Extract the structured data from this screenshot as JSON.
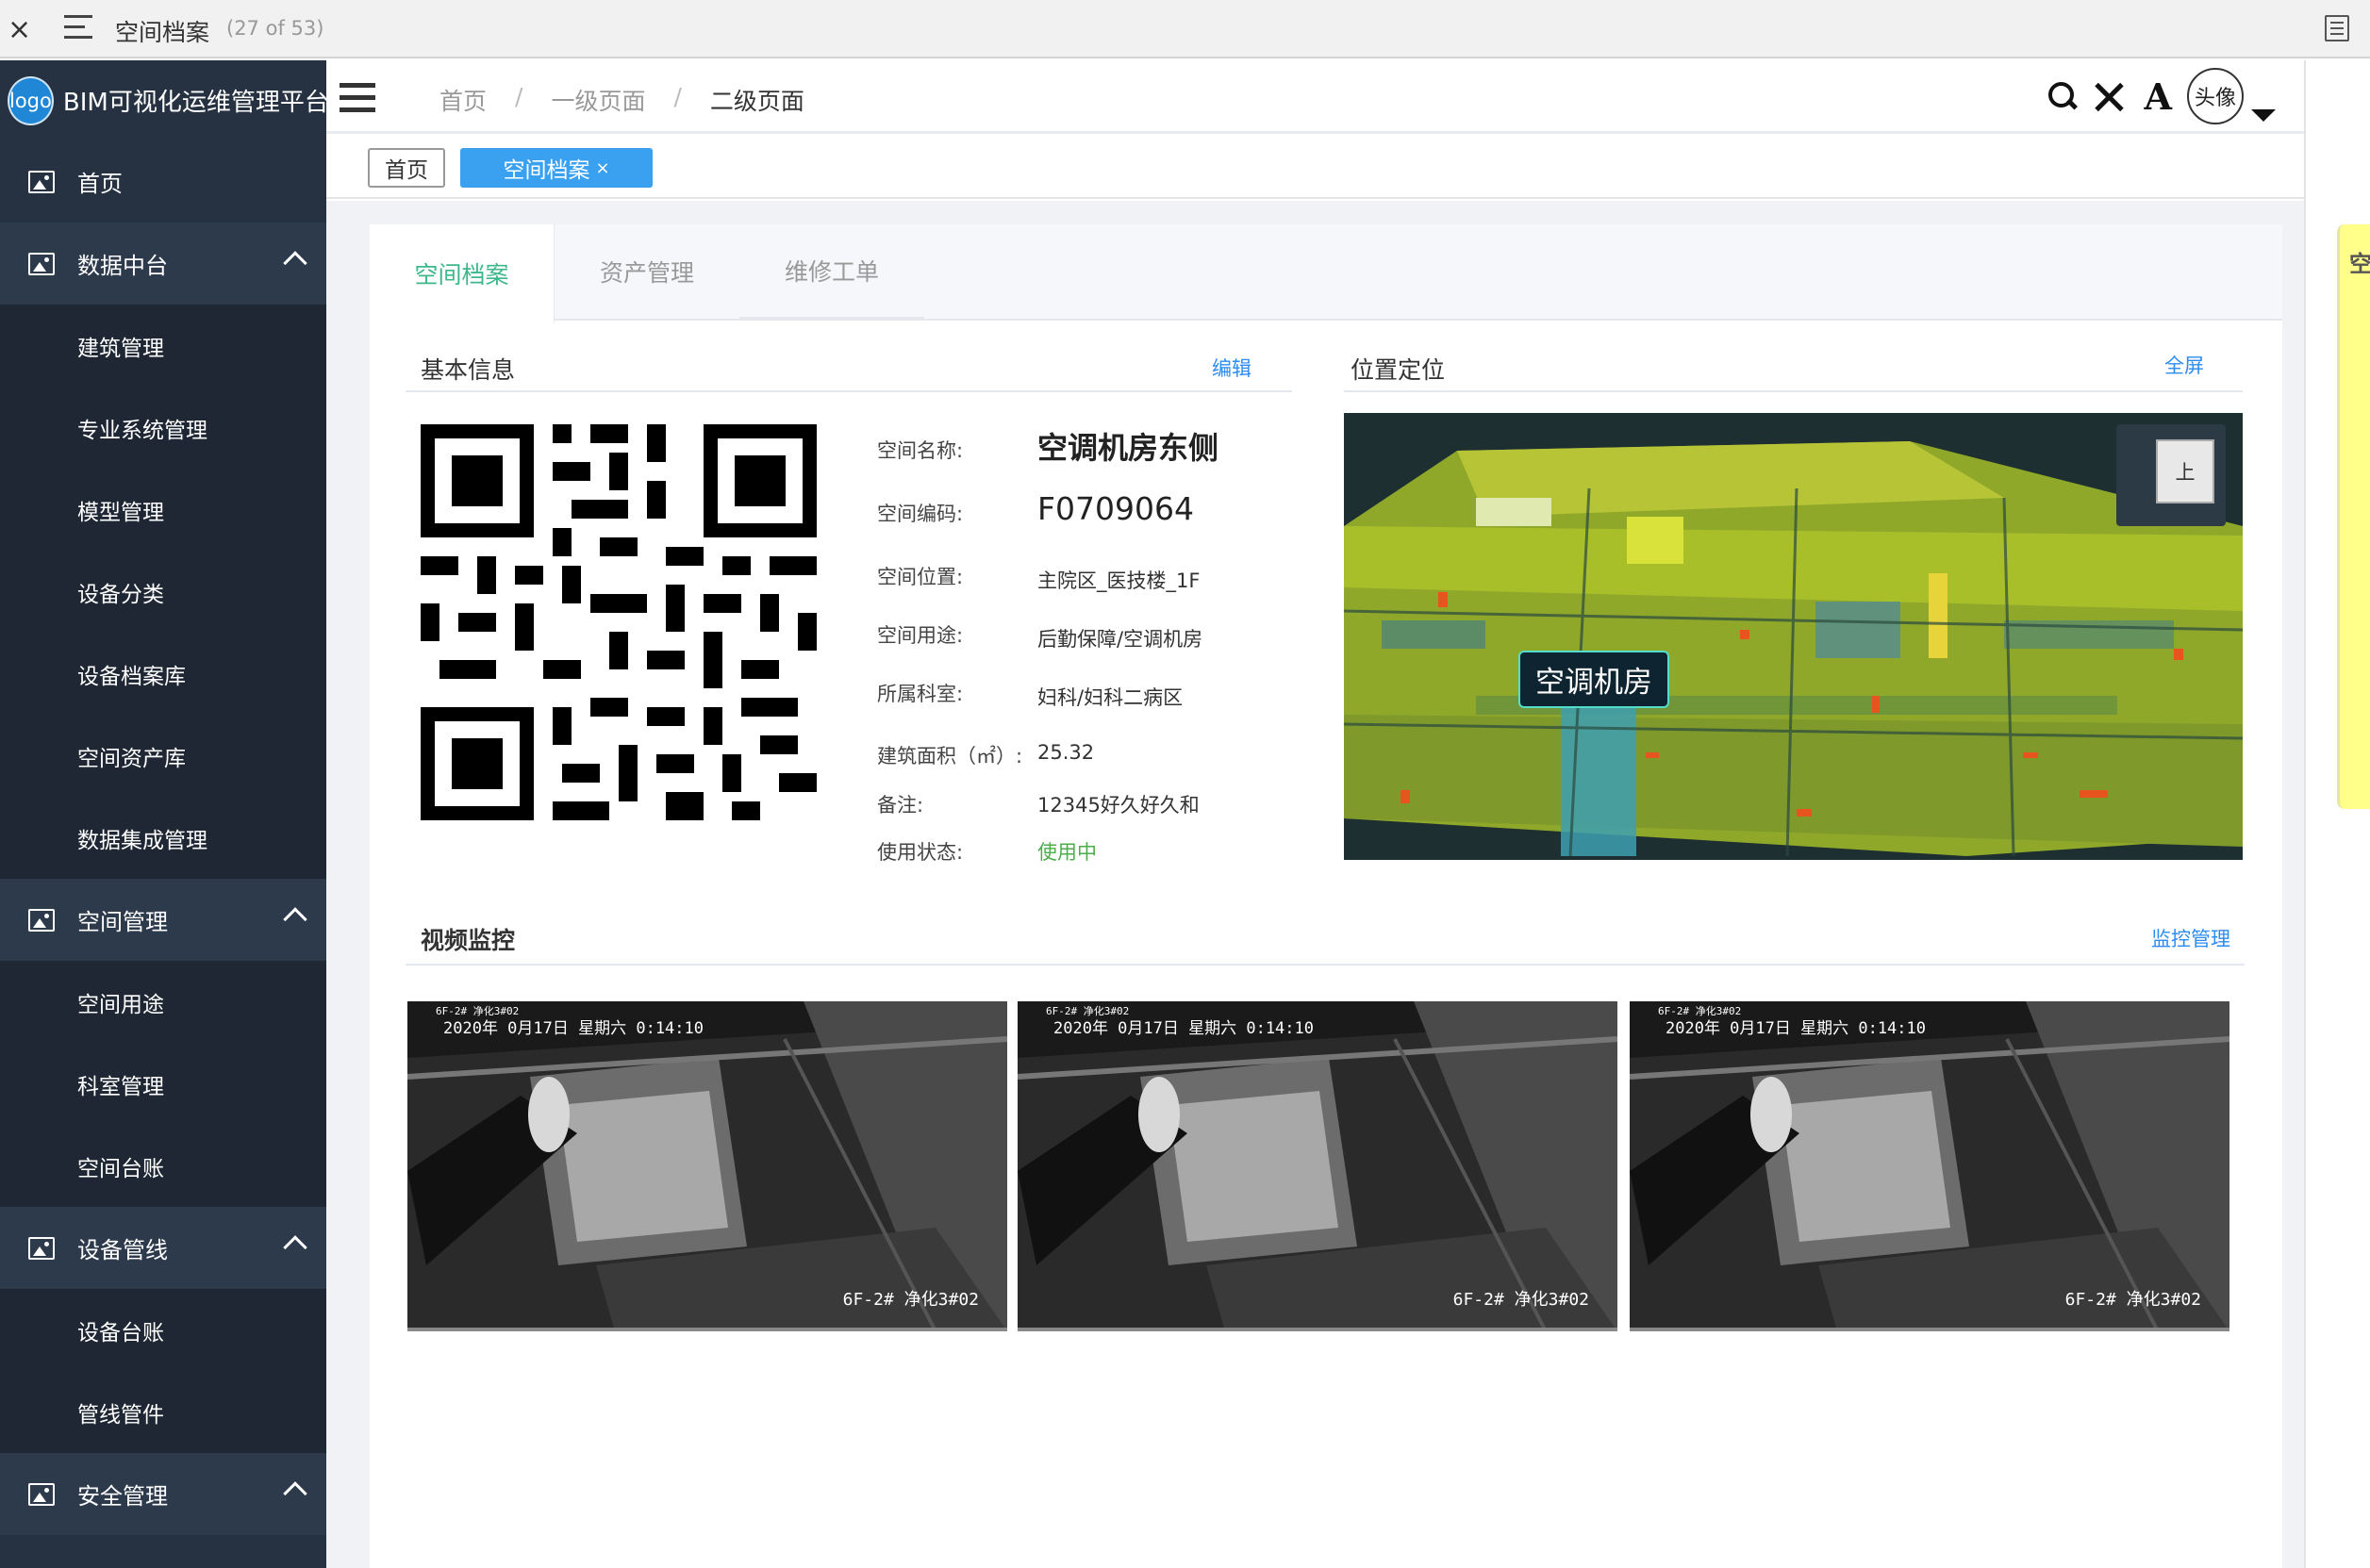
{
  "viewer": {
    "close": "×",
    "title": "空间档案",
    "count": "(27 of 53)"
  },
  "brand": {
    "logo": "logo",
    "name": "BIM可视化运维管理平台"
  },
  "sidebar": {
    "items": [
      {
        "label": "首页"
      },
      {
        "label": "数据中台"
      },
      {
        "label": "建筑管理"
      },
      {
        "label": "专业系统管理"
      },
      {
        "label": "模型管理"
      },
      {
        "label": "设备分类"
      },
      {
        "label": "设备档案库"
      },
      {
        "label": "空间资产库"
      },
      {
        "label": "数据集成管理"
      },
      {
        "label": "空间管理"
      },
      {
        "label": "空间用途"
      },
      {
        "label": "科室管理"
      },
      {
        "label": "空间台账"
      },
      {
        "label": "设备管线"
      },
      {
        "label": "设备台账"
      },
      {
        "label": "管线管件"
      },
      {
        "label": "安全管理"
      }
    ]
  },
  "breadcrumb": {
    "home": "首页",
    "sep1": "/",
    "level1": "一级页面",
    "sep2": "/",
    "level2": "二级页面"
  },
  "header": {
    "font_icon": "A",
    "avatar": "头像"
  },
  "tags": {
    "home": "首页",
    "active": "空间档案",
    "close": "×"
  },
  "tabs": [
    {
      "label": "空间档案"
    },
    {
      "label": "资产管理"
    },
    {
      "label": "维修工单"
    }
  ],
  "basic": {
    "title": "基本信息",
    "edit": "编辑",
    "fields": [
      {
        "label": "空间名称:",
        "value": "空调机房东侧"
      },
      {
        "label": "空间编码:",
        "value": "F0709064"
      },
      {
        "label": "空间位置:",
        "value": "主院区_医技楼_1F"
      },
      {
        "label": "空间用途:",
        "value": "后勤保障/空调机房"
      },
      {
        "label": "所属科室:",
        "value": "妇科/妇科二病区"
      },
      {
        "label": "建筑面积（㎡）:",
        "value": "25.32"
      },
      {
        "label": "备注:",
        "value": "12345好久好久和"
      },
      {
        "label": "使用状态:",
        "value": "使用中"
      }
    ]
  },
  "location": {
    "title": "位置定位",
    "fullscreen": "全屏",
    "label": "空调机房",
    "cube_face": "上"
  },
  "video": {
    "title": "视频监控",
    "manage": "监控管理",
    "cameras": [
      {
        "small": "6F-2# 净化3#02",
        "timestamp": "2020年 0月17日 星期六 0:14:10",
        "name": "6F-2# 净化3#02"
      },
      {
        "small": "6F-2# 净化3#02",
        "timestamp": "2020年 0月17日 星期六 0:14:10",
        "name": "6F-2# 净化3#02"
      },
      {
        "small": "6F-2# 净化3#02",
        "timestamp": "2020年 0月17日 星期六 0:14:10",
        "name": "6F-2# 净化3#02"
      }
    ]
  },
  "right_note": {
    "text": "空"
  },
  "colors": {
    "sidebar_bg": "#263241",
    "sidebar_sub_bg": "#1e2733",
    "tab_active": "#3cb88a",
    "tag_active": "#3aa0f0",
    "link": "#2d8cf0",
    "status_green": "#4cae4c"
  }
}
